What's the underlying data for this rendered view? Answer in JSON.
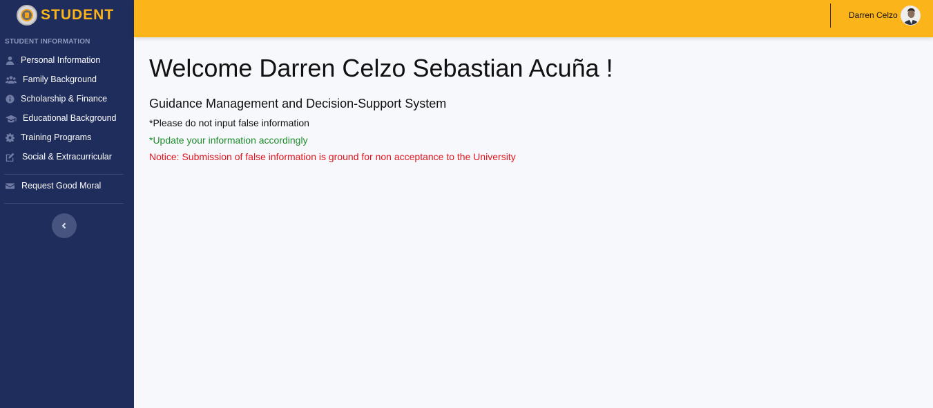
{
  "brand": {
    "name": "STUDENT"
  },
  "sidebar": {
    "section_title": "STUDENT INFORMATION",
    "items": [
      {
        "label": "Personal Information",
        "icon": "user-icon"
      },
      {
        "label": "Family Background",
        "icon": "users-icon"
      },
      {
        "label": "Scholarship & Finance",
        "icon": "info-circle-icon"
      },
      {
        "label": "Educational Background",
        "icon": "graduation-cap-icon"
      },
      {
        "label": "Training Programs",
        "icon": "gear-icon"
      },
      {
        "label": "Social & Extracurricular",
        "icon": "edit-icon"
      }
    ],
    "secondary_items": [
      {
        "label": "Request Good Moral",
        "icon": "envelope-icon"
      }
    ],
    "toggle_icon": "chevron-left-icon"
  },
  "topbar": {
    "user_name": "Darren Celzo",
    "avatar_icon": "user-avatar"
  },
  "main": {
    "welcome": "Welcome Darren Celzo Sebastian Acuña !",
    "system_name": "Guidance Management and Decision-Support System",
    "note1": "*Please do not input false information",
    "note2": "*Update your information accordingly",
    "note3": "Notice: Submission of false information is ground for non acceptance to the University"
  },
  "colors": {
    "sidebar_bg": "#1f2d5c",
    "topbar_bg": "#fbb41a",
    "brand_text": "#fbb41a",
    "success_text": "#1e8a2b",
    "danger_text": "#e3141c"
  }
}
